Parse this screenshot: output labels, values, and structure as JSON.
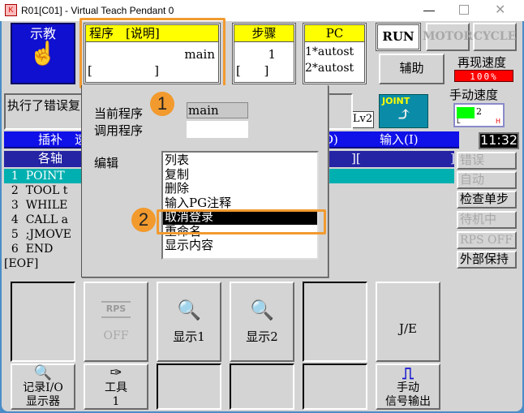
{
  "window": {
    "title": "R01[C01] - Virtual Teach Pendant 0",
    "controls": [
      "minimize",
      "maximize",
      "close"
    ]
  },
  "header": {
    "teach_button": "示教",
    "program": {
      "header": "程序　[说明]",
      "value": "main",
      "comment": "[                ]"
    },
    "step": {
      "header": "步骤",
      "value": "1",
      "comment": "[      ]"
    },
    "pc": {
      "header": "PC",
      "line1": "1*autost",
      "line2": "2*autost"
    },
    "run": "RUN",
    "motor": "MOTOR",
    "cycle": "CYCLE",
    "aux": "辅助",
    "replay_speed_label": "再现速度",
    "replay_speed": "100%",
    "manual_speed_label": "手动速度",
    "manual_speed_value": "2",
    "manual_speed_low": "L",
    "manual_speed_high": "H",
    "joint": "JOINT",
    "level": "Lv2"
  },
  "message": "执行了错误复",
  "status_bar": {
    "left": "插补　速",
    "mid": "D)",
    "right": "输入(I)",
    "clock": "11:32"
  },
  "axis_bar": {
    "left": "各轴",
    "mid": "][",
    "right": "]"
  },
  "program_lines": [
    "  1  POINT",
    "  2  TOOL t",
    "  3  WHILE",
    "  4  CALL a",
    "  5  ;JMOVE",
    "  6  END",
    "[EOF]"
  ],
  "side_buttons": [
    {
      "label": "错误",
      "enabled": false
    },
    {
      "label": "自动",
      "enabled": false
    },
    {
      "label": "检查单步",
      "enabled": true
    },
    {
      "label": "待机中",
      "enabled": false
    },
    {
      "label": "RPS OFF",
      "enabled": false
    },
    {
      "label": "外部保持",
      "enabled": true
    }
  ],
  "popup": {
    "current_program_label": "当前程序",
    "current_program": "main",
    "call_program_label": "调用程序",
    "call_program": "",
    "edit_label": "编辑",
    "edit_items": [
      "列表",
      "复制",
      "删除",
      "输入PG注释",
      "取消登录",
      "重命名",
      "显示内容"
    ],
    "selected_index": 4
  },
  "badges": [
    "1",
    "2"
  ],
  "function_keys": {
    "row1": [
      "",
      "RPS|OFF",
      "显示1",
      "显示2",
      "",
      "J/E"
    ],
    "rps_icon": "RPS",
    "rps_label": "OFF",
    "display1": "显示1",
    "display2": "显示2",
    "je": "J/E",
    "io_monitor": "记录I/O\n显示器",
    "tool": "工具\n1",
    "manual_output": "手动\n信号输出"
  },
  "colors": {
    "accent_blue": "#1010d0",
    "highlight_orange": "#f29a2e",
    "teal": "#00b0b0",
    "header_yellow": "#ffff00",
    "speed_red": "#ff0000"
  }
}
